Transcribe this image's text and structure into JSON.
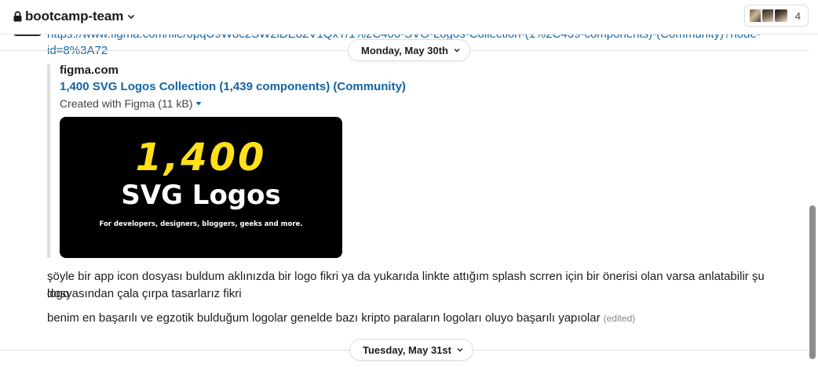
{
  "header": {
    "channel_name": "bootcamp-team",
    "member_count": "4",
    "icons": {
      "lock": "lock-icon",
      "dropdown": "chevron-down-icon"
    }
  },
  "message_top": {
    "link_line1": "https://www.figma.com/file/0pqU9W8c2SW2iDE82V1QxT/1%2C400-SVG-Logos-Collection-(1%2C439-components)-(Community)?node-",
    "link_line2": "id=8%3A72"
  },
  "date_divider_1": {
    "label": "Monday, May 30th"
  },
  "attachment": {
    "site": "figma.com",
    "title": "1,400 SVG Logos Collection (1,439 components) (Community)",
    "meta": "Created with Figma (11 kB)",
    "preview": {
      "headline": "1,400",
      "subtitle": "SVG Logos",
      "tagline": "For developers, designers, bloggers, geeks and more."
    }
  },
  "messages": [
    {
      "text": "şöyle bir app icon dosyası buldum aklınızda bir logo fikri ya da yukarıda linkte attığım splash scrren için bir önerisi olan varsa anlatabilir şu logo"
    },
    {
      "text": "dosyasından çala çırpa tasarlarız fikri"
    },
    {
      "text": "benim en başarılı ve egzotik bulduğum logolar genelde bazı kripto paraların logoları oluyo başarılı yapıolar",
      "edited": "(edited)"
    }
  ],
  "date_divider_2": {
    "label": "Tuesday, May 31st"
  },
  "colors": {
    "link": "#1264a3",
    "accent_yellow": "#ffe01b",
    "text": "#1d1c1d"
  }
}
